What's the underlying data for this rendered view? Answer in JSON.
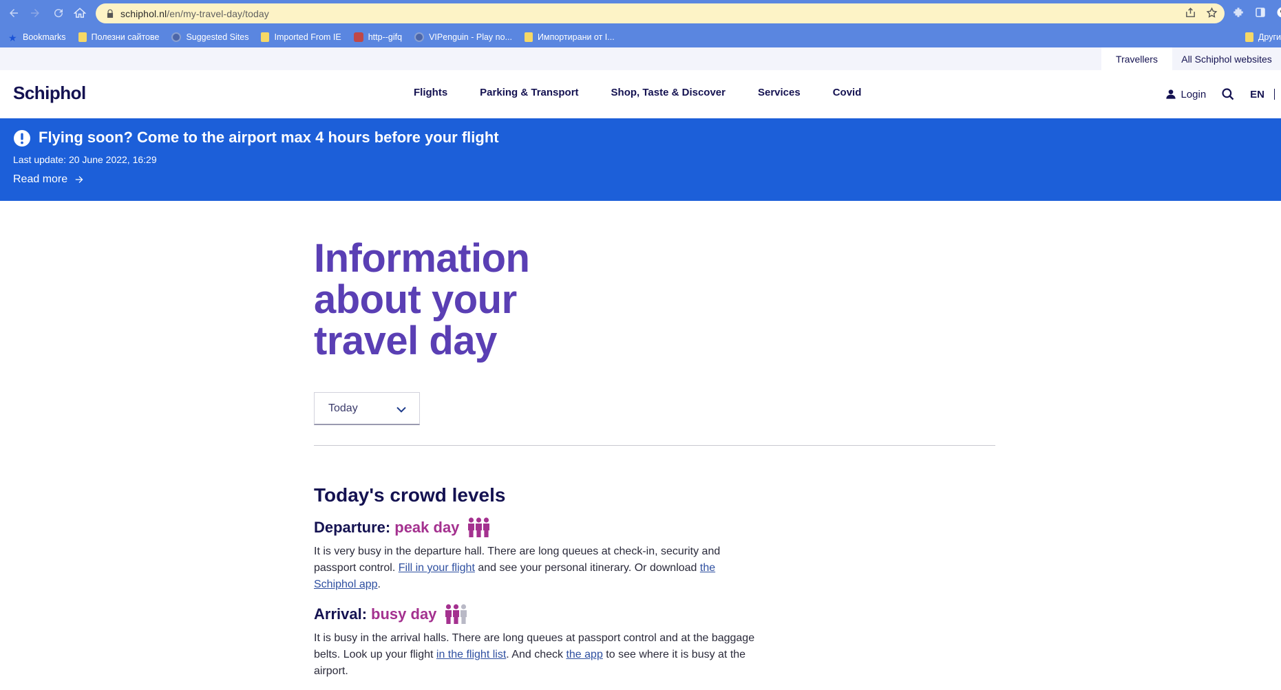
{
  "browser": {
    "url_host": "schiphol.nl",
    "url_path": "/en/my-travel-day/today",
    "bookmarks": [
      {
        "label": "Bookmarks",
        "icon": "star-icon"
      },
      {
        "label": "Полезни сайтове",
        "icon": "folder-icon"
      },
      {
        "label": "Suggested Sites",
        "icon": "globe-icon"
      },
      {
        "label": "Imported From IE",
        "icon": "folder-icon"
      },
      {
        "label": "http--gifq",
        "icon": "site-icon"
      },
      {
        "label": "VIPenguin - Play no...",
        "icon": "globe-icon"
      },
      {
        "label": "Импортирани от I...",
        "icon": "folder-icon"
      }
    ],
    "other_bookmarks": "Други"
  },
  "util_bar": {
    "travellers": "Travellers",
    "all_sites": "All Schiphol websites"
  },
  "header": {
    "logo": "Schiphol",
    "nav": [
      "Flights",
      "Parking & Transport",
      "Shop, Taste & Discover",
      "Services",
      "Covid"
    ],
    "login": "Login",
    "lang": "EN"
  },
  "alert": {
    "title": "Flying soon? Come to the airport max 4 hours before your flight",
    "update": "Last update: 20 June 2022, 16:29",
    "read_more": "Read more"
  },
  "main": {
    "title_line1": "Information",
    "title_line2": "about your",
    "title_line3": "travel day",
    "day_select": "Today",
    "section_title": "Today's crowd levels",
    "departure": {
      "label": "Departure:",
      "value": "peak day",
      "level": 3,
      "text1": "It is very busy in the departure hall. There are long queues at check-in, security and passport control. ",
      "link1": "Fill in your flight",
      "text2": " and see your personal itinerary. Or download ",
      "link2": "the Schiphol app",
      "text3": "."
    },
    "arrival": {
      "label": "Arrival:",
      "value": "busy day",
      "level": 2,
      "text1": "It is busy in the arrival halls. There are long queues at passport control and at the baggage belts. Look up your flight ",
      "link1": "in the flight list",
      "text2": ". And check ",
      "link2": "the app",
      "text3": " to see where it is busy at the airport."
    }
  },
  "colors": {
    "brand_navy": "#141251",
    "alert_blue": "#1c5fd9",
    "title_purple": "#5a3fb4",
    "level_magenta": "#a4318f",
    "level_inactive": "#b9b9c6"
  }
}
